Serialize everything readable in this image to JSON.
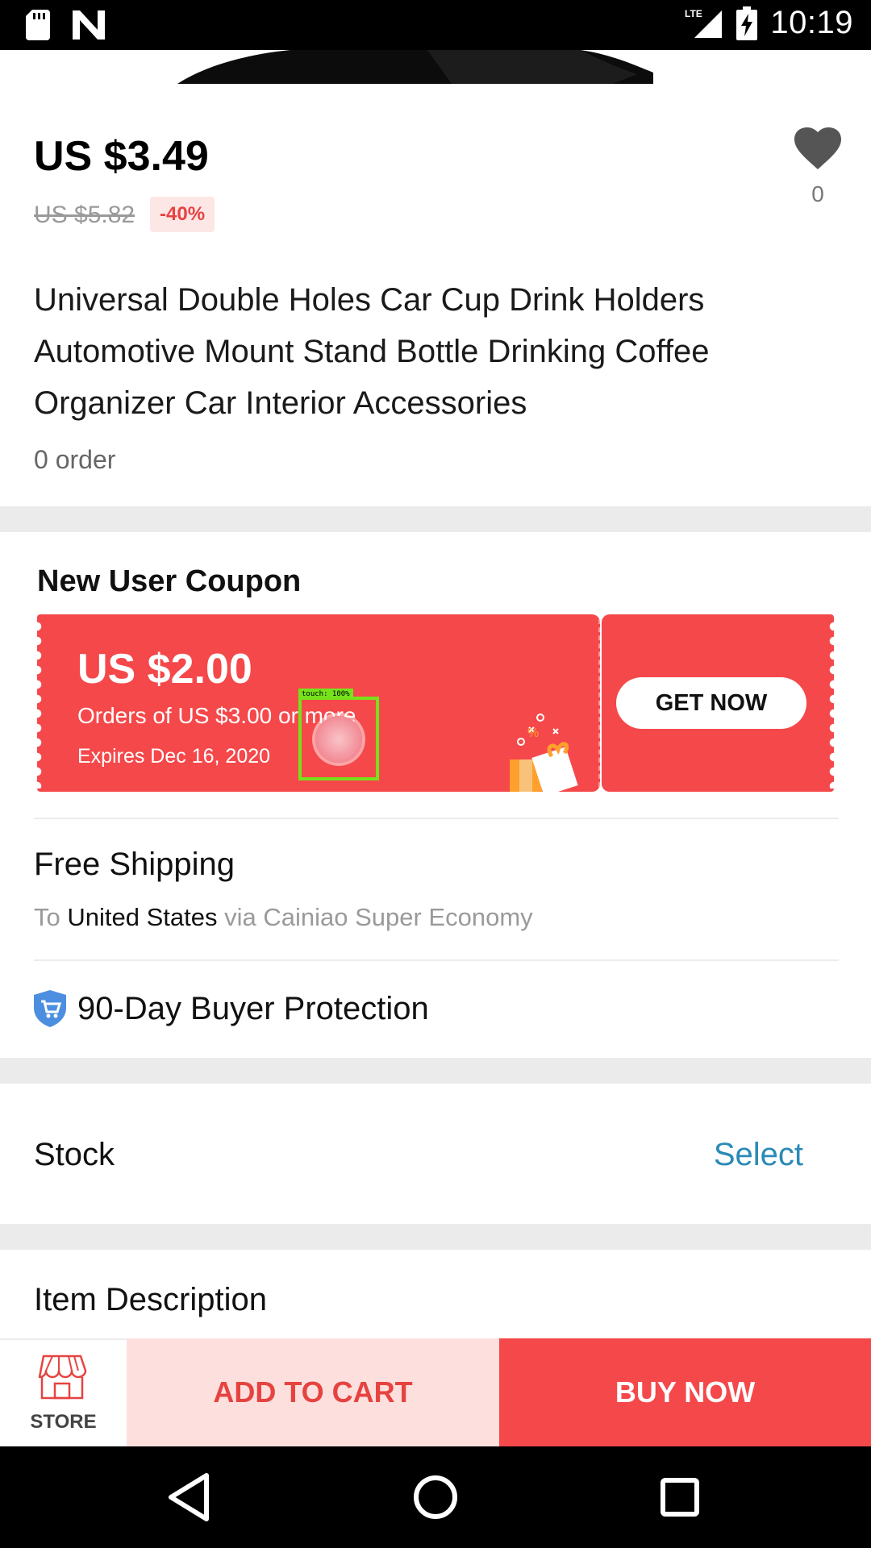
{
  "status_bar": {
    "time": "10:19",
    "network": "LTE"
  },
  "product": {
    "price": "US $3.49",
    "original_price": "US $5.82",
    "discount": "-40%",
    "wishlist_count": "0",
    "title": "Universal Double Holes Car Cup Drink Holders Automotive Mount Stand Bottle Drinking Coffee Organizer Car Interior Accessories",
    "orders": "0 order"
  },
  "coupon": {
    "heading": "New User Coupon",
    "amount": "US $2.00",
    "condition": "Orders of US $3.00 or more",
    "expires": "Expires Dec 16, 2020",
    "cta": "GET NOW"
  },
  "touch_indicator": {
    "label": "touch: 100%"
  },
  "shipping": {
    "title": "Free Shipping",
    "to_prefix": "To",
    "destination": "United States",
    "via": "via Cainiao Super Economy"
  },
  "protection": {
    "label": "90-Day Buyer Protection"
  },
  "stock": {
    "label": "Stock",
    "action": "Select"
  },
  "description": {
    "label": "Item Description"
  },
  "bottom_bar": {
    "store": "STORE",
    "add_to_cart": "ADD TO CART",
    "buy_now": "BUY NOW"
  },
  "colors": {
    "accent": "#f5484a",
    "link": "#2a8ab7",
    "cart_bg": "#fde0de"
  }
}
